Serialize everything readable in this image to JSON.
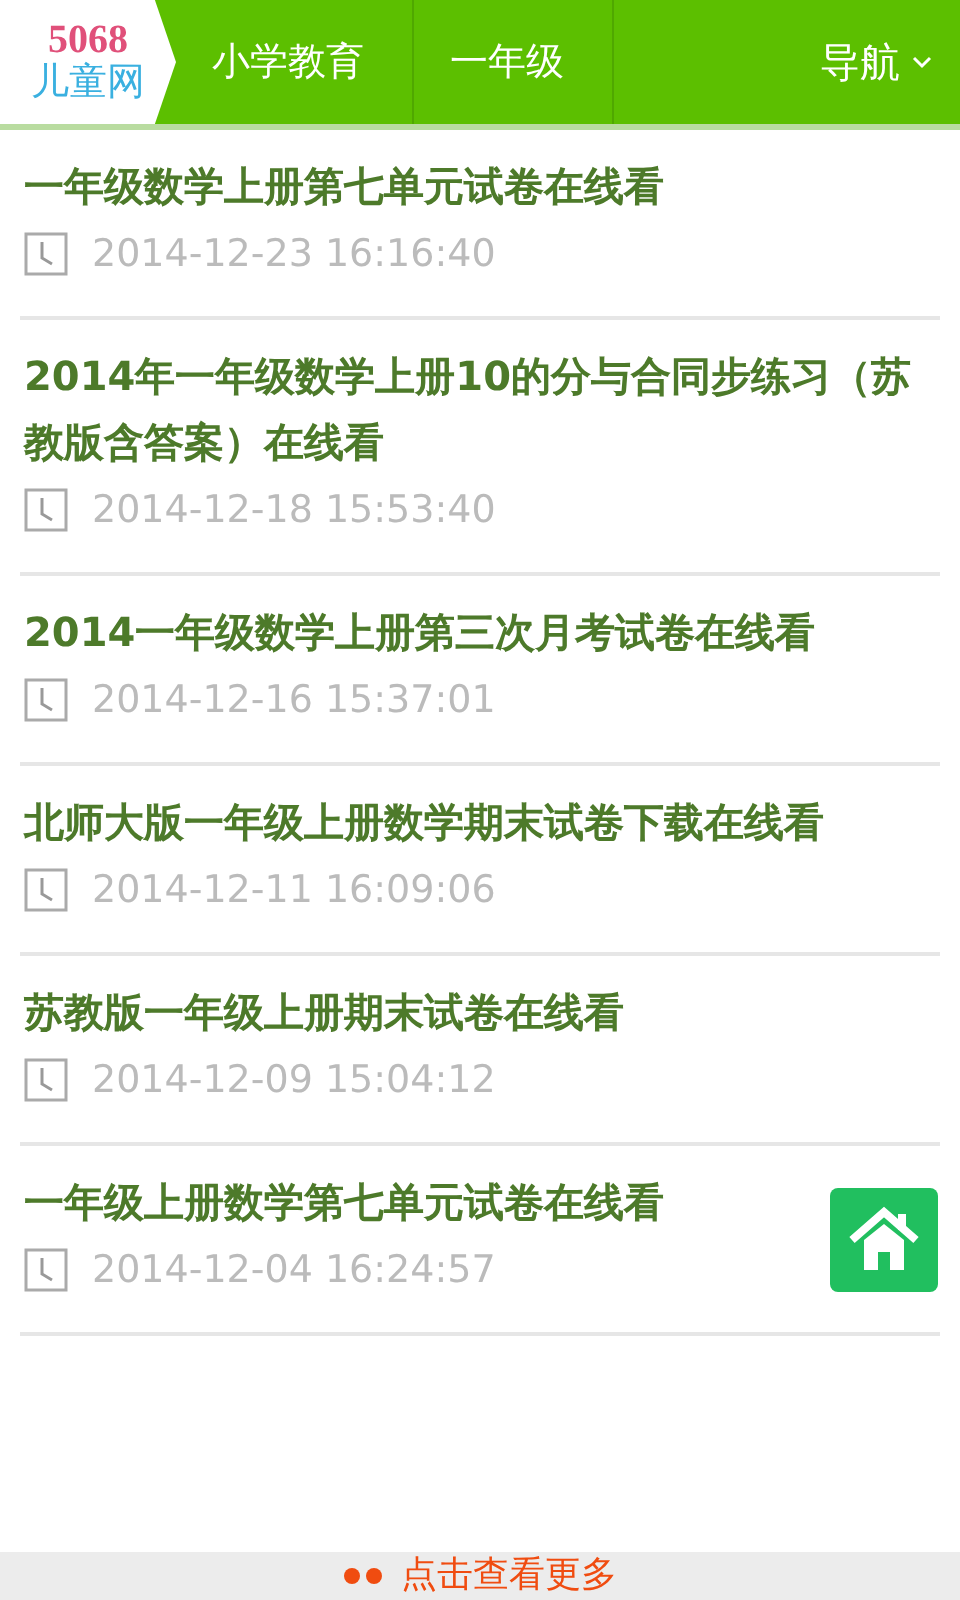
{
  "header": {
    "logo_number": "5068",
    "logo_name": "儿童网",
    "breadcrumbs": [
      "小学教育",
      "一年级"
    ],
    "nav": "导航"
  },
  "articles": [
    {
      "title": "一年级数学上册第七单元试卷在线看",
      "time": "2014-12-23 16:16:40"
    },
    {
      "title": "2014年一年级数学上册10的分与合同步练习（苏教版含答案）在线看",
      "time": "2014-12-18 15:53:40"
    },
    {
      "title": "2014一年级数学上册第三次月考试卷在线看",
      "time": "2014-12-16 15:37:01"
    },
    {
      "title": "北师大版一年级上册数学期末试卷下载在线看",
      "time": "2014-12-11 16:09:06"
    },
    {
      "title": "苏教版一年级上册期末试卷在线看",
      "time": "2014-12-09 15:04:12"
    },
    {
      "title": "一年级上册数学第七单元试卷在线看",
      "time": "2014-12-04 16:24:57"
    }
  ],
  "more": "点击查看更多"
}
